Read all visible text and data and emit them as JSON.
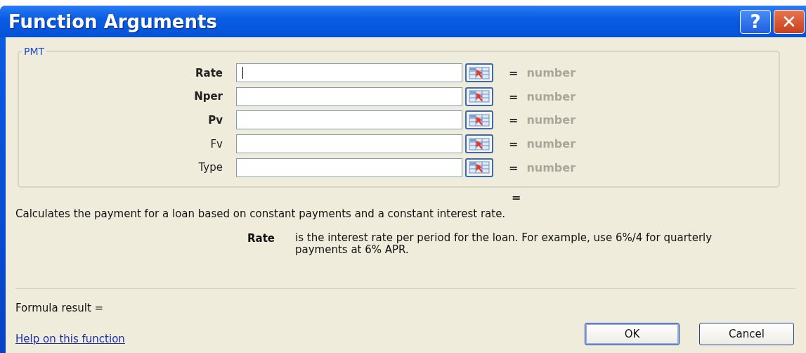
{
  "window": {
    "title": "Function Arguments",
    "help_button": "?",
    "close_button": "✕"
  },
  "function": {
    "name": "PMT",
    "arguments": [
      {
        "label": "Rate",
        "required": true,
        "focused": true,
        "result": "=",
        "result_value": "number"
      },
      {
        "label": "Nper",
        "required": true,
        "focused": false,
        "result": "=",
        "result_value": "number"
      },
      {
        "label": "Pv",
        "required": true,
        "focused": false,
        "result": "=",
        "result_value": "number"
      },
      {
        "label": "Fv",
        "required": false,
        "focused": false,
        "result": "=",
        "result_value": "number"
      },
      {
        "label": "Type",
        "required": false,
        "focused": false,
        "result": "=",
        "result_value": "number"
      }
    ],
    "result": "="
  },
  "description": "Calculates the payment for a loan based on constant payments and a constant interest rate.",
  "argument_help": {
    "name": "Rate",
    "text": "is the interest rate per period for the loan. For example, use 6%/4 for quarterly payments at 6% APR."
  },
  "formula_result": "Formula result =",
  "help_link": "Help on this function",
  "buttons": [
    {
      "label": "OK",
      "default": true
    },
    {
      "label": "Cancel",
      "default": false
    }
  ]
}
